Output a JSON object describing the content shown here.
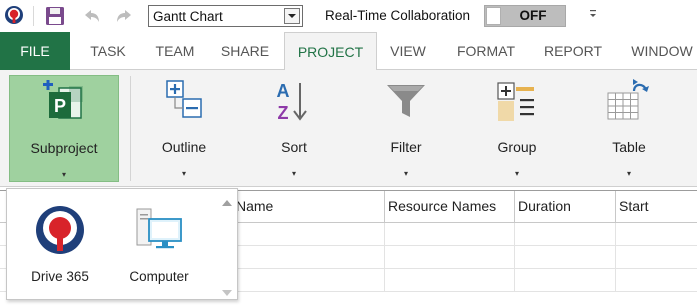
{
  "quick_access": {
    "view_select": {
      "value": "Gantt Chart"
    },
    "collaboration": {
      "label": "Real-Time Collaboration",
      "state": "OFF"
    },
    "icons": [
      "app-logo-icon",
      "save-icon",
      "undo-icon",
      "redo-icon",
      "chevron-down-icon",
      "customize-icon"
    ]
  },
  "tabs": [
    {
      "label": "FILE"
    },
    {
      "label": "TASK"
    },
    {
      "label": "TEAM"
    },
    {
      "label": "SHARE"
    },
    {
      "label": "PROJECT"
    },
    {
      "label": "VIEW"
    },
    {
      "label": "FORMAT"
    },
    {
      "label": "REPORT"
    },
    {
      "label": "WINDOW"
    }
  ],
  "active_tab": "PROJECT",
  "ribbon": {
    "subproject": {
      "label": "Subproject",
      "icon": "subproject-icon",
      "dropdown": "▾"
    },
    "outline": {
      "label": "Outline",
      "icon": "outline-icon",
      "dropdown": "▾"
    },
    "sort": {
      "label": "Sort",
      "icon": "sort-icon",
      "dropdown": "▾"
    },
    "filter": {
      "label": "Filter",
      "icon": "filter-icon",
      "dropdown": "▾"
    },
    "group": {
      "label": "Group",
      "icon": "group-icon",
      "dropdown": "▾"
    },
    "table": {
      "label": "Table",
      "icon": "table-icon",
      "dropdown": "▾"
    }
  },
  "grid": {
    "columns": [
      "Name",
      "Resource Names",
      "Duration",
      "Start"
    ]
  },
  "popup": {
    "items": [
      {
        "label": "Drive 365",
        "icon": "drive-365-icon"
      },
      {
        "label": "Computer",
        "icon": "computer-icon"
      }
    ]
  },
  "colors": {
    "accent": "#217346",
    "subproject_highlight": "#9fd19f",
    "logo_blue": "#1f3f7a",
    "logo_red": "#d8232a"
  }
}
